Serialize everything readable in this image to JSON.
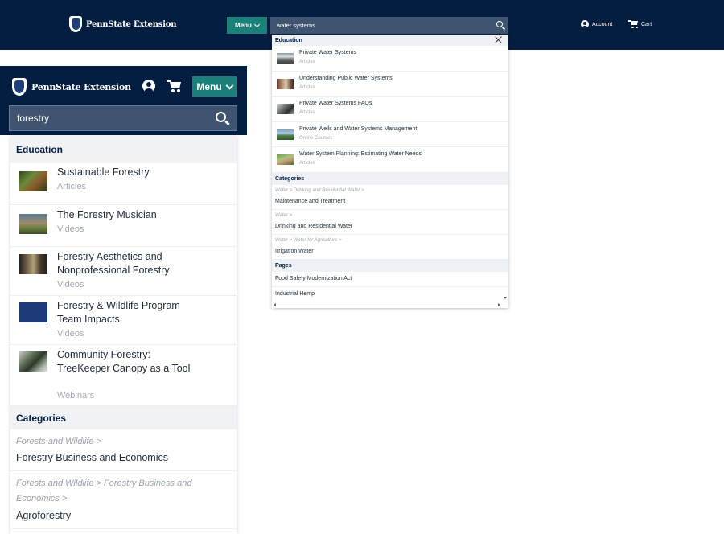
{
  "desktop": {
    "logo_text": "PennState Extension",
    "menu_label": "Menu",
    "search_value": "water systems",
    "account_label": "Account",
    "cart_label": "Cart",
    "dropdown": {
      "education_label": "Education",
      "items": [
        {
          "title": "Private Water Systems",
          "type": "Articles"
        },
        {
          "title": "Understanding Public Water Systems",
          "type": "Articles"
        },
        {
          "title": "Private Water Systems FAQs",
          "type": "Articles"
        },
        {
          "title": "Private Wells and Water Systems Management",
          "type": "Online Courses"
        },
        {
          "title": "Water System Planning: Estimating Water Needs",
          "type": "Articles"
        }
      ],
      "categories_label": "Categories",
      "categories": [
        {
          "path": "Water > Drinking and Residential Water >",
          "name": "Maintenance and Treatment"
        },
        {
          "path": "Water >",
          "name": "Drinking and Residential Water"
        },
        {
          "path": "Water > Water for Agriculture >",
          "name": "Irrigation Water"
        }
      ],
      "pages_label": "Pages",
      "pages": [
        "Food Safety Modernization Act",
        "Industrial Hemp"
      ]
    }
  },
  "mobile": {
    "logo_text": "PennState Extension",
    "menu_label": "Menu",
    "search_value": "forestry",
    "dropdown": {
      "education_label": "Education",
      "items": [
        {
          "title": "Sustainable Forestry",
          "type": "Articles"
        },
        {
          "title": "The Forestry Musician",
          "type": "Videos"
        },
        {
          "title": "Forestry Aesthetics and Nonprofessional Forestry",
          "type": "Videos"
        },
        {
          "title": "Forestry & Wildlife Program Team Impacts",
          "type": "Videos"
        },
        {
          "title": "Community Forestry: TreeKeeper Canopy as a Tool",
          "type": "Webinars"
        }
      ],
      "categories_label": "Categories",
      "categories": [
        {
          "path": "Forests and Wildlife >",
          "name": "Forestry Business and Economics"
        },
        {
          "path": "Forests and Wildlife > Forestry Business and Economics >",
          "name": "Agroforestry"
        }
      ]
    }
  },
  "colors": {
    "navy": "#041e42",
    "teal": "#1a8079",
    "search_bg": "#3f5471"
  }
}
